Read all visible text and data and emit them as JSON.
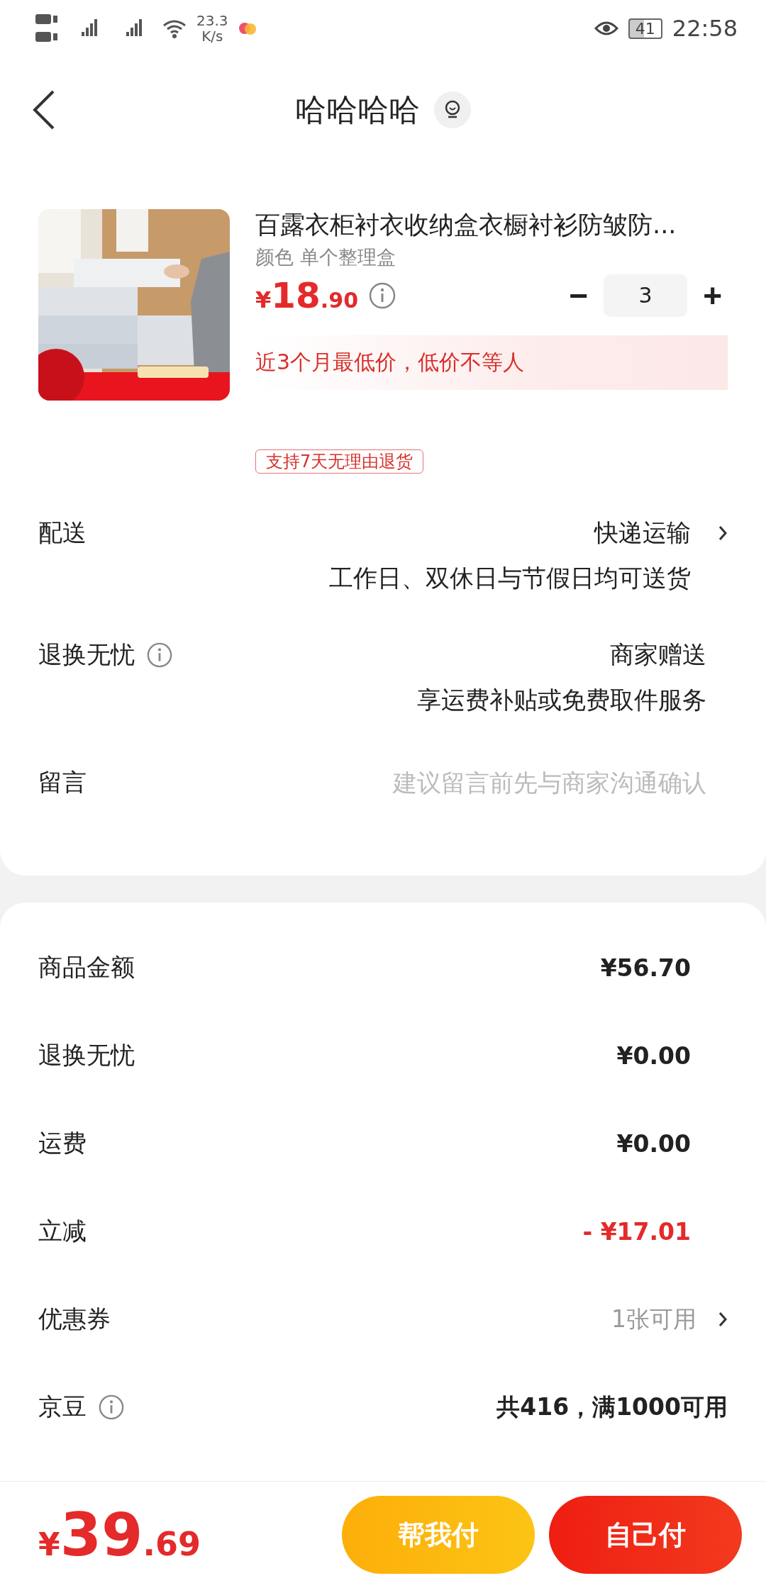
{
  "status_bar": {
    "network_speed": "23.3",
    "network_unit": "K/s",
    "battery": "41",
    "time": "22:58"
  },
  "header": {
    "title": "哈哈哈哈"
  },
  "product": {
    "title": "百露衣柜衬衣收纳盒衣橱衬衫防皱防...",
    "variant": "颜色 单个整理盒",
    "price_symbol": "¥",
    "price_int": "18",
    "price_dec": ".90",
    "quantity": "3",
    "decrease": "−",
    "increase": "+",
    "promo": "近3个月最低价，低价不等人",
    "tag": "支持7天无理由退货"
  },
  "options": [
    {
      "kind": "delivery",
      "label": "配送",
      "value": "快递运输",
      "sub": "工作日、双休日与节假日均可送货",
      "info": false,
      "chevron": true
    },
    {
      "kind": "service",
      "label": "退换无忧",
      "value": "商家赠送",
      "sub": "享运费补贴或免费取件服务",
      "info": true,
      "chevron": false
    },
    {
      "kind": "note",
      "label": "留言",
      "placeholder": "建议留言前先与商家沟通确认"
    }
  ],
  "costs": [
    {
      "kind": "normal",
      "label": "商品金额",
      "value": "¥56.70",
      "info": false,
      "chevron": false
    },
    {
      "kind": "normal",
      "label": "退换无忧",
      "value": "¥0.00",
      "info": false,
      "chevron": false
    },
    {
      "kind": "normal",
      "label": "运费",
      "value": "¥0.00",
      "info": false,
      "chevron": false
    },
    {
      "kind": "discount",
      "label": "立减",
      "value": "- ¥17.01",
      "info": false,
      "chevron": false
    },
    {
      "kind": "muted",
      "label": "优惠券",
      "value": "1张可用",
      "info": false,
      "chevron": true
    },
    {
      "kind": "normal",
      "label": "京豆",
      "value": "共416，满1000可用",
      "info": true,
      "chevron": false
    }
  ],
  "bottom_bar": {
    "total_symbol": "¥",
    "total_int": "39",
    "total_dec": ".69",
    "buttons": [
      {
        "kind": "secondary",
        "label": "帮我付"
      },
      {
        "kind": "primary",
        "label": "自己付"
      }
    ]
  }
}
